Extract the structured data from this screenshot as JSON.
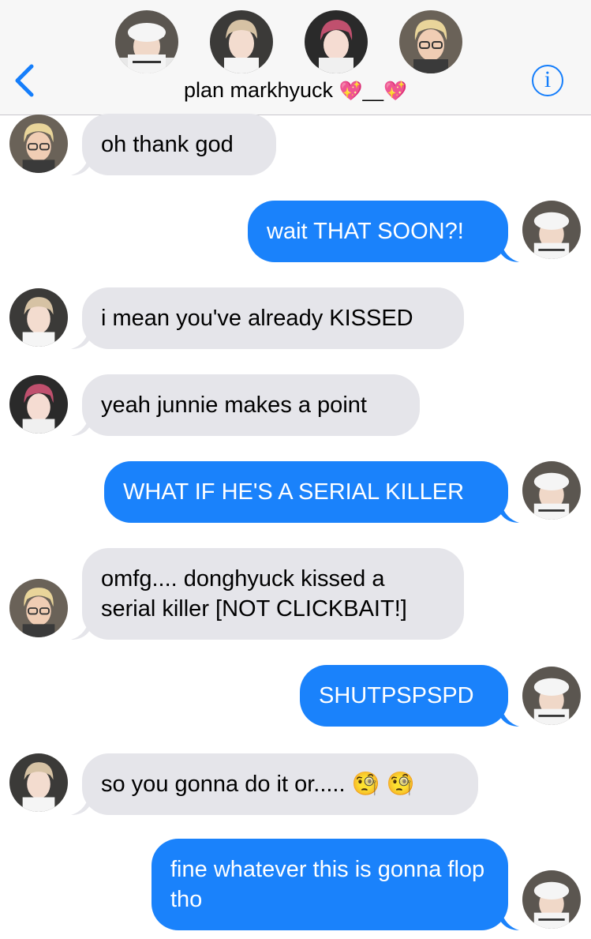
{
  "header": {
    "group_name": "plan markhyuck",
    "title_suffix": "💖__💖"
  },
  "messages": [
    {
      "from": "blond",
      "text": "oh thank god"
    },
    {
      "from": "me",
      "text": "wait THAT SOON?!"
    },
    {
      "from": "brunette",
      "text": "i mean you've already KISSED"
    },
    {
      "from": "pink",
      "text": "yeah junnie makes a point"
    },
    {
      "from": "me",
      "text": "WHAT IF HE'S A SERIAL KILLER"
    },
    {
      "from": "blond",
      "text": "omfg.... donghyuck kissed a serial killer [NOT CLICKBAIT!]"
    },
    {
      "from": "me",
      "text": "SHUTPSPSPD"
    },
    {
      "from": "brunette",
      "text": "so you gonna do it or..... 🧐 🧐"
    },
    {
      "from": "me",
      "text": "fine whatever this is gonna flop tho"
    }
  ],
  "colors": {
    "accent": "#157efb",
    "outgoing_bubble": "#1a82fb",
    "incoming_bubble": "#e5e5ea",
    "header_bg": "#f7f7f7"
  },
  "icons": {
    "back": "chevron-left-icon",
    "info": "info-icon"
  }
}
